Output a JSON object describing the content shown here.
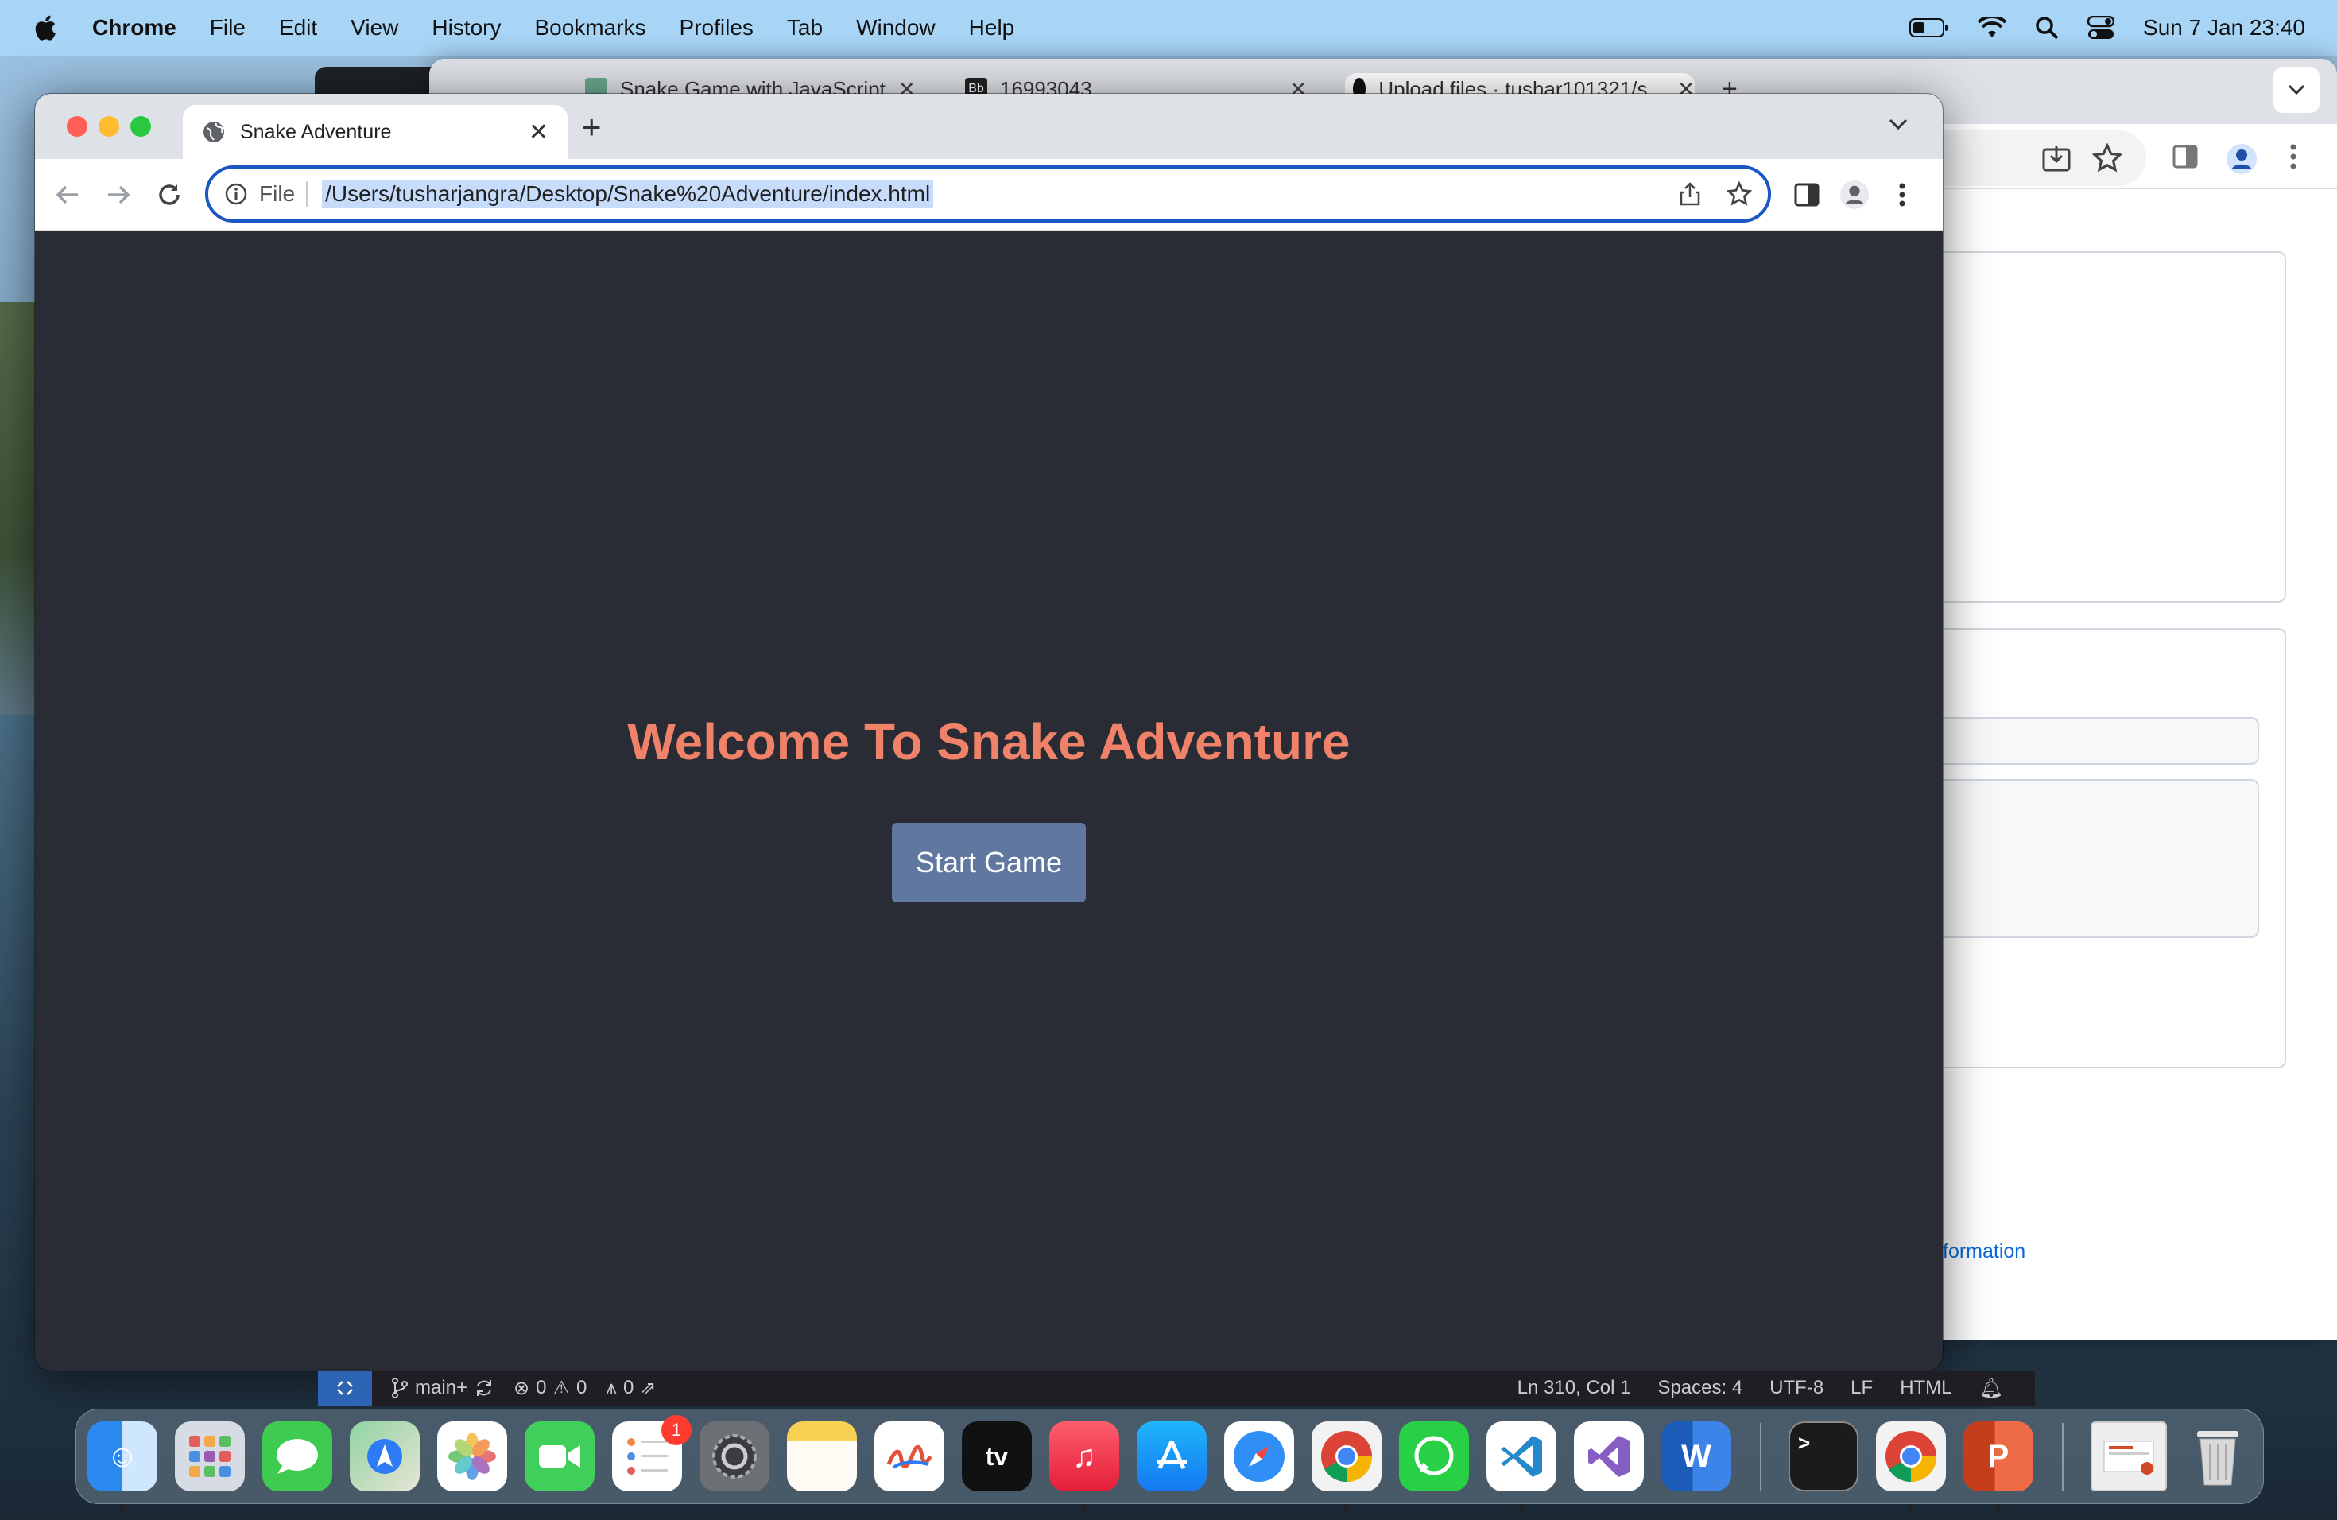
{
  "menubar": {
    "app": "Chrome",
    "items": [
      "File",
      "Edit",
      "View",
      "History",
      "Bookmarks",
      "Profiles",
      "Tab",
      "Window",
      "Help"
    ],
    "clock": "Sun 7 Jan  23:40"
  },
  "back_window": {
    "tabs": [
      {
        "label": "Snake Game with JavaScript"
      },
      {
        "label": "16993043"
      },
      {
        "label": "Upload files · tushar101321/s..."
      }
    ],
    "page_text": "formation"
  },
  "window": {
    "tab_title": "Snake Adventure",
    "omnibox": {
      "scheme": "File",
      "url": "/Users/tusharjangra/Desktop/Snake%20Adventure/index.html"
    }
  },
  "page": {
    "heading": "Welcome To Snake Adventure",
    "start_button": "Start Game"
  },
  "statusbar": {
    "branch": "main+",
    "errors": "0",
    "warnings": "0",
    "ports": "0",
    "position": "Ln 310, Col 1",
    "spaces": "Spaces: 4",
    "encoding": "UTF-8",
    "eol": "LF",
    "language": "HTML"
  },
  "dock": {
    "reminders_badge": "1",
    "apps": [
      "finder-icon",
      "launchpad-icon",
      "messages-icon",
      "maps-icon",
      "photos-icon",
      "facetime-icon",
      "reminders-icon",
      "system-settings-icon",
      "notes-icon",
      "freeform-icon",
      "apple-tv-icon",
      "music-icon",
      "app-store-icon",
      "safari-icon",
      "chrome-icon",
      "whatsapp-icon",
      "vscode-icon",
      "visual-studio-icon",
      "word-icon",
      "terminal-icon",
      "chrome-icon-2",
      "powerpoint-icon",
      "downloads-stack-icon",
      "trash-icon"
    ]
  },
  "colors": {
    "page_bg": "#292c35",
    "heading": "#ef8268",
    "button": "#6078a0",
    "omnibox_border": "#1a56c4"
  }
}
